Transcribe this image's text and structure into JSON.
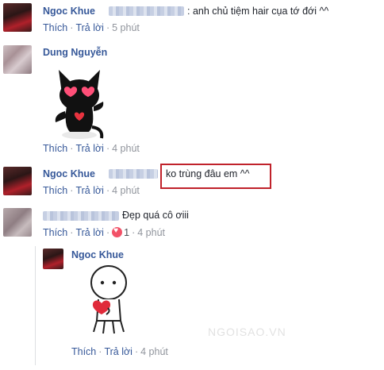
{
  "comments": [
    {
      "name": "Ngoc Khue",
      "text": ": anh chủ tiệm hair cụa tớ đới ^^",
      "actions": {
        "like": "Thích",
        "reply": "Trả lời",
        "time": "5 phút"
      }
    },
    {
      "name": "Dung Nguyễn",
      "actions": {
        "like": "Thích",
        "reply": "Trả lời",
        "time": "4 phút"
      }
    },
    {
      "name": "Ngoc Khue",
      "text": "ko trùng đâu em ^^",
      "actions": {
        "like": "Thích",
        "reply": "Trả lời",
        "time": "4 phút"
      }
    },
    {
      "text": "Đẹp quá cô ơiii",
      "actions": {
        "like": "Thích",
        "reply": "Trả lời",
        "reactions": "1",
        "time": "4 phút"
      }
    }
  ],
  "reply": {
    "name": "Ngoc Khue",
    "actions": {
      "like": "Thích",
      "reply": "Trả lời",
      "time": "4 phút"
    }
  },
  "watermark": "NGOISAO.VN",
  "colors": {
    "link": "#365899",
    "highlight": "#c0222b",
    "muted": "#90949c",
    "reaction": "#f25268"
  }
}
